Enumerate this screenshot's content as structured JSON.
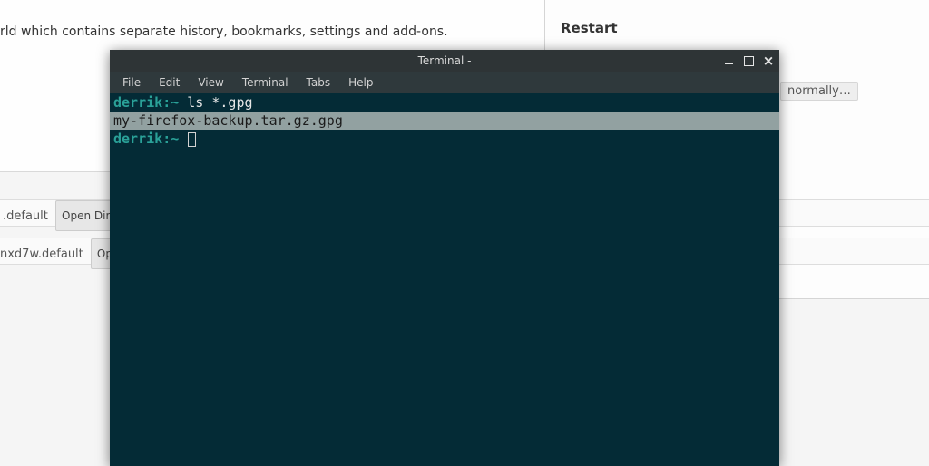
{
  "background": {
    "description_text": "rld which contains separate history, bookmarks, settings and add-ons.",
    "row1_profile": ".default",
    "row1_button": "Open Directory",
    "row2_profile": "nxd7w.default",
    "row2_button": "Open Dir",
    "right_title": "Restart",
    "badge": "normally…"
  },
  "terminal": {
    "title": "Terminal -",
    "menus": [
      "File",
      "Edit",
      "View",
      "Terminal",
      "Tabs",
      "Help"
    ],
    "lines": [
      {
        "type": "prompt",
        "user": "derrik",
        "path": "~",
        "command": "ls *.gpg"
      },
      {
        "type": "output-highlight",
        "text": "my-firefox-backup.tar.gz.gpg"
      },
      {
        "type": "prompt",
        "user": "derrik",
        "path": "~",
        "command": ""
      }
    ]
  }
}
